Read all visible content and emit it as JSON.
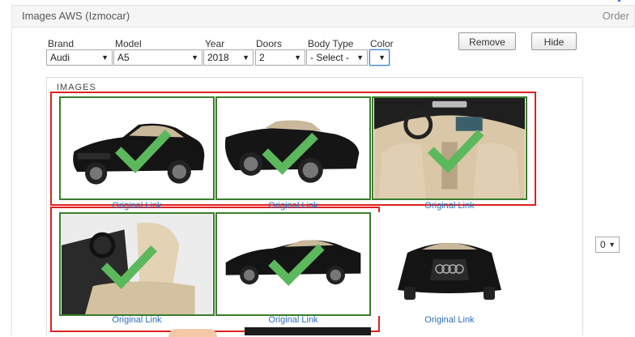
{
  "header": {
    "title": "Images AWS (Izmocar)",
    "order_label": "Order"
  },
  "filters": {
    "brand": {
      "label": "Brand",
      "value": "Audi"
    },
    "model": {
      "label": "Model",
      "value": "A5"
    },
    "year": {
      "label": "Year",
      "value": "2018"
    },
    "doors": {
      "label": "Doors",
      "value": "2"
    },
    "body_type": {
      "label": "Body Type",
      "value": "- Select -"
    },
    "color": {
      "label": "Color",
      "value": ""
    }
  },
  "actions": {
    "remove_label": "Remove",
    "hide_label": "Hide"
  },
  "images": {
    "section_title": "IMAGES",
    "link_label": "Original Link",
    "items": [
      {
        "view": "front-three-quarter",
        "selected": true
      },
      {
        "view": "rear-three-quarter",
        "selected": true
      },
      {
        "view": "dashboard-interior",
        "selected": true
      },
      {
        "view": "seat-interior",
        "selected": true
      },
      {
        "view": "side-profile",
        "selected": true
      },
      {
        "view": "front",
        "selected": false
      }
    ]
  },
  "order": {
    "value": "0"
  },
  "colors": {
    "selection_frame": "#e02020",
    "selected_border": "#3a7d2e",
    "check": "#5cb85c",
    "link": "#2a6ebb"
  },
  "icons": {
    "check": "checkmark-icon",
    "dropdown": "chevron-down-icon"
  }
}
